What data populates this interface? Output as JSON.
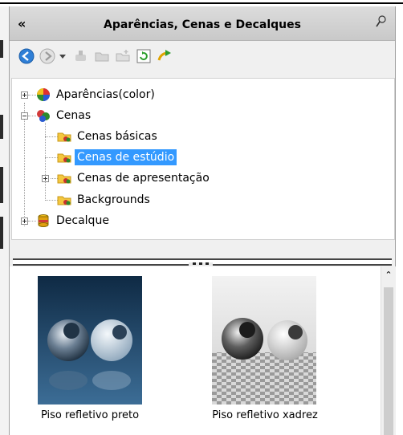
{
  "panel": {
    "title": "Aparências, Cenas e Decalques",
    "collapse_glyph": "«"
  },
  "toolbar": {
    "icons": [
      "back-icon",
      "forward-icon",
      "dropdown-arrow-icon",
      "tool-icon",
      "folder-open-icon",
      "new-folder-icon",
      "refresh-icon",
      "upload-icon"
    ]
  },
  "tree": {
    "items": [
      {
        "label": "Aparências(color)",
        "icon": "appearance-sphere-icon"
      },
      {
        "label": "Cenas",
        "icon": "scenes-icon"
      },
      {
        "label": "Cenas básicas",
        "icon": "folder-scene-icon"
      },
      {
        "label": "Cenas de estúdio",
        "icon": "folder-scene-icon",
        "selected": true
      },
      {
        "label": "Cenas de apresentação",
        "icon": "folder-scene-icon"
      },
      {
        "label": "Backgrounds",
        "icon": "folder-scene-icon"
      },
      {
        "label": "Decalque",
        "icon": "decal-icon"
      }
    ]
  },
  "gallery": {
    "items": [
      {
        "label": "Piso refletivo preto"
      },
      {
        "label": "Piso refletivo xadrez"
      }
    ]
  },
  "colors": {
    "selection": "#3399ff",
    "titlebar": "#d0d0d0"
  }
}
